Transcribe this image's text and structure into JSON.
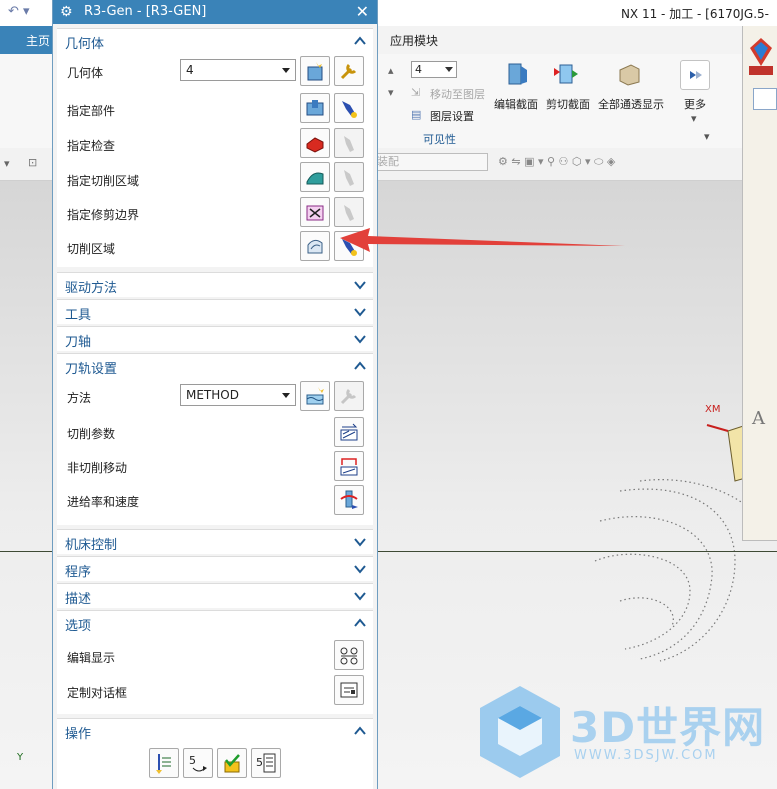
{
  "app": {
    "window_title": "NX 11 - 加工 - [6170JG.5-"
  },
  "ribbon": {
    "tab_home": "主页",
    "tab_app": "应用模块",
    "layer_value": "4",
    "move_to_layer": "移动至图层",
    "layer_settings": "图层设置",
    "edit_section": "编辑截面",
    "clip_section": "剪切截面",
    "show_all_passes": "全部通透显示",
    "more": "更多",
    "visibility_group": "可见性",
    "assembly_filter": "装配"
  },
  "viewport": {
    "xm_label": "XM",
    "y_label": "Y"
  },
  "watermark": {
    "brand": "3D世界网",
    "url": "WWW.3DSJW.COM"
  },
  "dialog": {
    "title": "R3-Gen - [R3-GEN]",
    "sections": {
      "geometry": "几何体",
      "drive_method": "驱动方法",
      "tool": "工具",
      "tool_axis": "刀轴",
      "path_settings": "刀轨设置",
      "machine_control": "机床控制",
      "program": "程序",
      "description": "描述",
      "options": "选项",
      "actions": "操作"
    },
    "geometry": {
      "geometry_label": "几何体",
      "geometry_value": "4",
      "specify_part": "指定部件",
      "specify_check": "指定检查",
      "specify_cut_area": "指定切削区域",
      "specify_trim": "指定修剪边界",
      "cut_area": "切削区域"
    },
    "path_settings": {
      "method_label": "方法",
      "method_value": "METHOD",
      "cut_params": "切削参数",
      "non_cut_moves": "非切削移动",
      "feeds_speeds": "进给率和速度"
    },
    "options": {
      "edit_display": "编辑显示",
      "customize_dialog": "定制对话框"
    }
  },
  "colors": {
    "title_blue": "#3a83b8",
    "section_text": "#1f5a92",
    "arrow_red": "#e2403a"
  }
}
